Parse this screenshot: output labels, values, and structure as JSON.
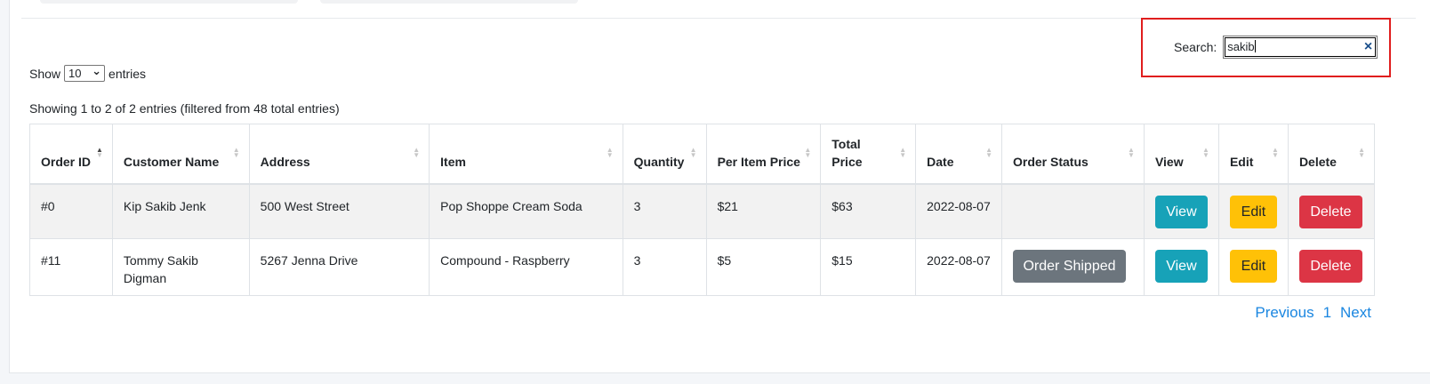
{
  "search": {
    "label": "Search:",
    "value": "sakib",
    "clear_icon": "×"
  },
  "length": {
    "prefix": "Show",
    "selected": "10",
    "suffix": "entries",
    "chevron": "⌄"
  },
  "info": "Showing 1 to 2 of 2 entries (filtered from 48 total entries)",
  "table": {
    "columns": [
      "Order ID",
      "Customer Name",
      "Address",
      "Item",
      "Quantity",
      "Per Item Price",
      "Total Price",
      "Date",
      "Order Status",
      "View",
      "Edit",
      "Delete"
    ],
    "rows": [
      {
        "order_id": "#0",
        "customer": "Kip Sakib Jenk",
        "address": "500 West Street",
        "item": "Pop Shoppe Cream Soda",
        "quantity": "3",
        "per_item_price": "$21",
        "total_price": "$63",
        "date": "2022-08-07",
        "status": "",
        "view": "View",
        "edit": "Edit",
        "delete": "Delete"
      },
      {
        "order_id": "#11",
        "customer": "Tommy Sakib Digman",
        "address": "5267 Jenna Drive",
        "item": "Compound - Raspberry",
        "quantity": "3",
        "per_item_price": "$5",
        "total_price": "$15",
        "date": "2022-08-07",
        "status": "Order Shipped",
        "view": "View",
        "edit": "Edit",
        "delete": "Delete"
      }
    ]
  },
  "pagination": {
    "previous": "Previous",
    "page": "1",
    "next": "Next"
  },
  "colors": {
    "highlight": "#e01e1e",
    "info": "#17a2b8",
    "warning": "#ffc107",
    "danger": "#dc3545",
    "secondary": "#6c757d",
    "link": "#1a86e0"
  }
}
